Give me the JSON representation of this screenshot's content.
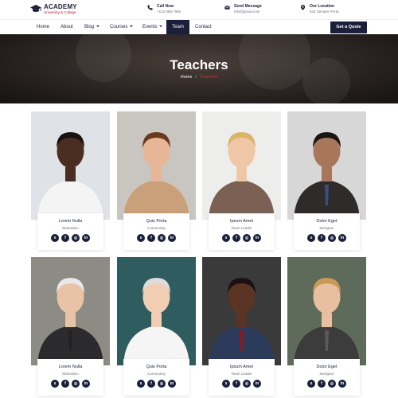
{
  "header": {
    "brand_title": "ACADEMY",
    "brand_subtitle": "University & College",
    "call": {
      "title": "Call Now",
      "value": "+123 4567 890"
    },
    "email": {
      "title": "Send Message",
      "value": "info@gmail.com"
    },
    "location": {
      "title": "Our Location",
      "value": "634 Semper Porta"
    }
  },
  "nav": {
    "items": [
      "Home",
      "About",
      "Blog",
      "Courses",
      "Events",
      "Team",
      "Contact"
    ],
    "active": "Team",
    "cta": "Get a Quote"
  },
  "hero": {
    "title": "Teachers",
    "breadcrumb_home": "Home",
    "breadcrumb_sep": "/",
    "breadcrumb_current": "Teachers"
  },
  "colors": {
    "navy": "#1b1f3b",
    "accent_red": "#d32f2f"
  },
  "teachers": [
    {
      "name": "Lorem Nulla",
      "role": "Illustration"
    },
    {
      "name": "Quis Porta",
      "role": "Community"
    },
    {
      "name": "Ipsum Amet",
      "role": "Team Leader"
    },
    {
      "name": "Dolor Eget",
      "role": "Designer"
    },
    {
      "name": "Lorem Nulla",
      "role": "Illustration"
    },
    {
      "name": "Quis Porta",
      "role": "Community"
    },
    {
      "name": "Ipsum Amet",
      "role": "Team Leader"
    },
    {
      "name": "Dolor Eget",
      "role": "Designer"
    }
  ],
  "social_icons": [
    "skype-icon",
    "facebook-icon",
    "dribbble-icon",
    "linkedin-icon"
  ],
  "social_glyphs": [
    "s",
    "f",
    "◎",
    "in"
  ]
}
